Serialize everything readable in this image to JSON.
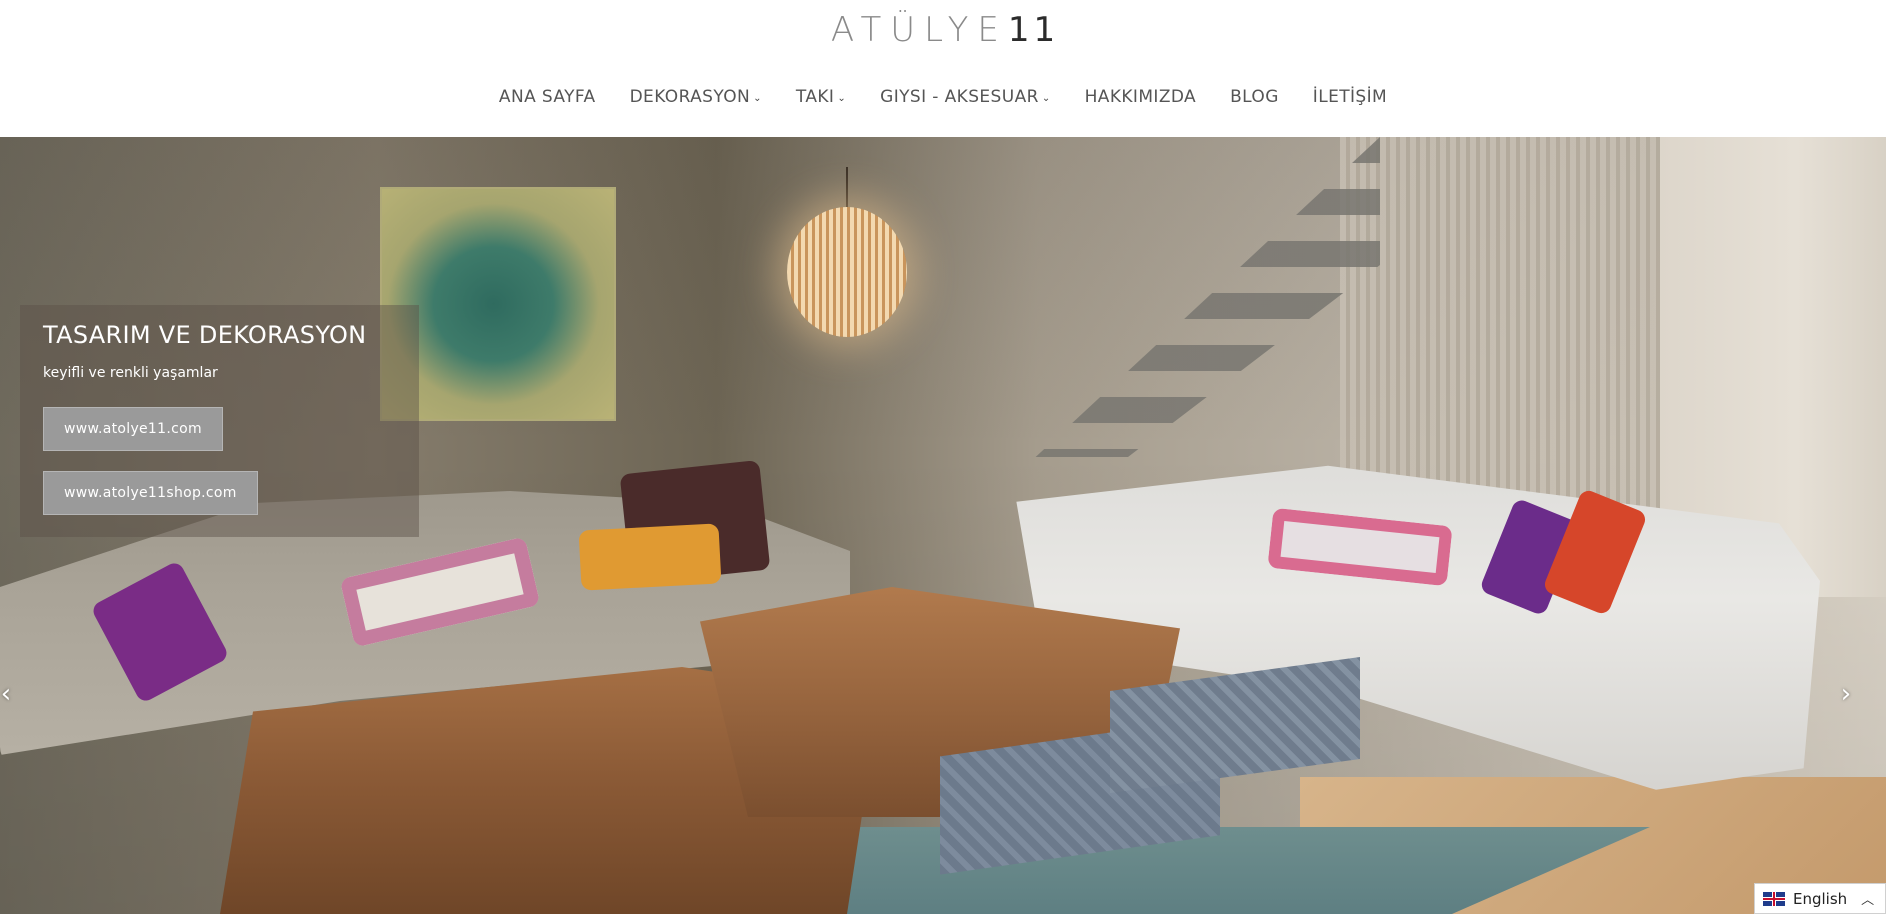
{
  "header": {
    "logo_text": "ATÜLYE",
    "logo_num": "11"
  },
  "nav": [
    {
      "label": "ANA SAYFA",
      "has_dropdown": false
    },
    {
      "label": "DEKORASYON",
      "has_dropdown": true
    },
    {
      "label": "TAKI",
      "has_dropdown": true
    },
    {
      "label": "GIYSI - AKSESUAR",
      "has_dropdown": true
    },
    {
      "label": "HAKKIMIZDA",
      "has_dropdown": false
    },
    {
      "label": "BLOG",
      "has_dropdown": false
    },
    {
      "label": "İLETİŞİM",
      "has_dropdown": false
    }
  ],
  "slider": {
    "title": "TASARIM VE DEKORASYON",
    "subtitle": "keyifli ve renkli yaşamlar",
    "buttons": [
      "www.atolye11.com",
      "www.atolye11shop.com"
    ],
    "prev_icon": "‹",
    "next_icon": "›"
  },
  "language": {
    "label": "English",
    "caret": "^"
  },
  "icons": {
    "dropdown": "chevron-down-icon",
    "prev": "chevron-left-icon",
    "next": "chevron-right-icon",
    "flag": "uk-flag-icon",
    "lang_caret": "chevron-up-icon"
  }
}
